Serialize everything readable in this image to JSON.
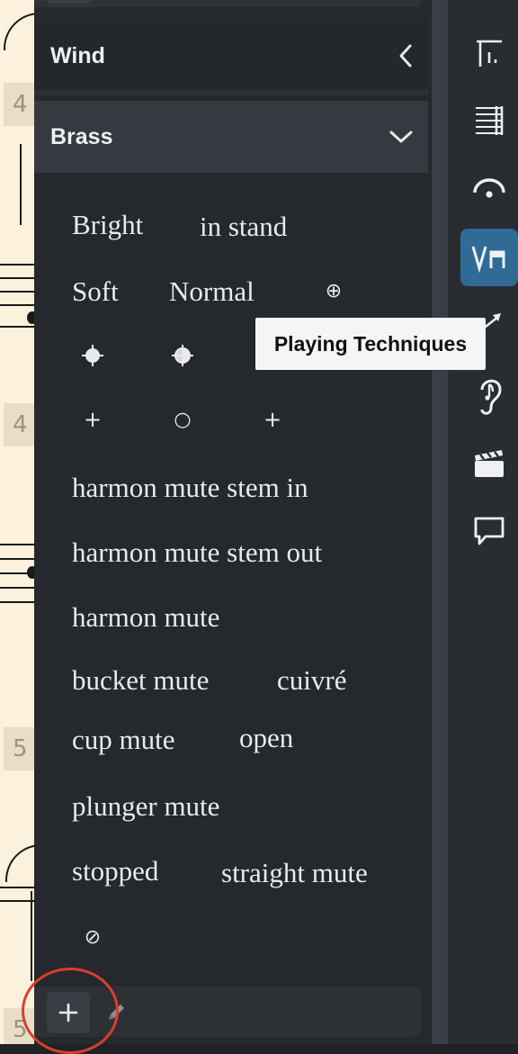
{
  "score": {
    "bar_numbers": [
      "4",
      "4",
      "5",
      "5"
    ]
  },
  "panel": {
    "sections": [
      {
        "label": "Wind",
        "state": "collapsed",
        "icon": "chevron-left-icon"
      },
      {
        "label": "Brass",
        "state": "expanded",
        "icon": "chevron-down-icon"
      }
    ],
    "techniques": {
      "bright": "Bright",
      "in_stand": "in stand",
      "soft": "Soft",
      "normal": "Normal",
      "harmon_mute_stem_in": "harmon mute stem in",
      "harmon_mute_stem_out": "harmon mute stem out",
      "harmon_mute": "harmon mute",
      "bucket_mute": "bucket mute",
      "cuivre": "cuivré",
      "cup_mute": "cup mute",
      "open": "open",
      "plunger_mute": "plunger mute",
      "stopped": "stopped",
      "straight_mute": "straight mute"
    },
    "glyphs": {
      "circle_plus": "⊕",
      "plus": "+",
      "open_circle": "○",
      "slashed_circle": "⊘"
    },
    "toolbar": {
      "add_icon": "plus-icon",
      "edit_icon": "pencil-icon",
      "add_label": "+"
    }
  },
  "right_toolbar": {
    "buttons": [
      {
        "name": "tempo-icon",
        "active": false
      },
      {
        "name": "repeat-structure-icon",
        "active": false
      },
      {
        "name": "holds-pauses-icon",
        "active": false
      },
      {
        "name": "playing-techniques-icon",
        "active": true
      },
      {
        "name": "ornaments-icon",
        "active": false
      },
      {
        "name": "ear-icon",
        "active": false
      },
      {
        "name": "clapperboard-icon",
        "active": false
      },
      {
        "name": "comment-icon",
        "active": false
      }
    ]
  },
  "tooltip": {
    "text": "Playing Techniques"
  },
  "colors": {
    "accent": "#2f6b95",
    "highlight_circle": "#d7402a",
    "panel_bg": "#25282d"
  }
}
